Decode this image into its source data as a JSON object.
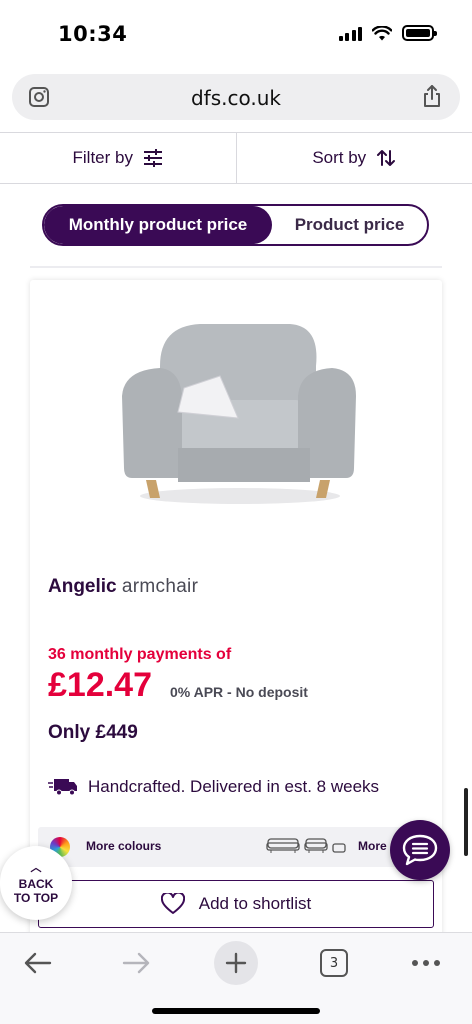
{
  "status_bar": {
    "time": "10:34"
  },
  "browser": {
    "url": "dfs.co.uk",
    "tab_count": "3"
  },
  "filters": {
    "filter_label": "Filter by",
    "sort_label": "Sort by"
  },
  "price_toggle": {
    "options": [
      "Monthly product price",
      "Product price"
    ],
    "selected": "Monthly product price"
  },
  "product": {
    "name_bold": "Angelic",
    "name_rest": "armchair",
    "monthly_label": "36 monthly payments of",
    "monthly_price": "£12.47",
    "apr_text": "0% APR - No deposit",
    "only_price": "Only £449",
    "delivery_text": "Handcrafted. Delivered in est. 8 weeks",
    "more_colours": "More colours",
    "more_sizes": "More sizes",
    "shortlist_label": "Add to shortlist"
  },
  "back_to_top": {
    "line1": "BACK",
    "line2": "TO TOP"
  },
  "colors": {
    "brand_purple": "#3a0a55",
    "price_red": "#e4003b",
    "text_dark": "#2c0b3e"
  },
  "icons": [
    "camera-search-icon",
    "share-icon",
    "filter-sliders-icon",
    "sort-arrows-icon",
    "delivery-truck-icon",
    "colour-wheel-icon",
    "sofa-size-icon",
    "heart-icon",
    "chat-icon",
    "back-arrow-icon",
    "forward-arrow-icon",
    "plus-icon",
    "tabs-icon",
    "more-icon"
  ]
}
